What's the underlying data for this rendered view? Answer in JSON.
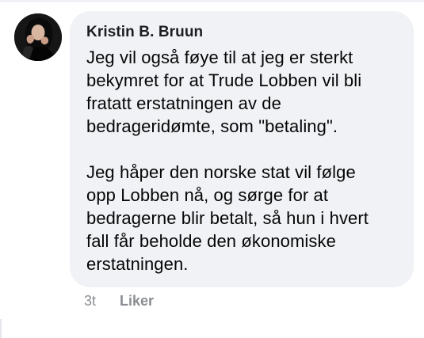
{
  "comment": {
    "author": "Kristin B. Bruun",
    "avatar_icon": "profile-photo",
    "text": "Jeg vil også føye til at jeg er sterkt\nbekymret for at Trude Lobben vil bli\nfratatt erstatningen av de\nbedrageridømte, som \"betaling\".\n\nJeg håper den norske stat vil følge\nopp Lobben nå, og sørge for at\nbedragerne blir betalt, så hun i hvert\nfall får beholde den økonomiske\nerstatningen.",
    "timestamp": "3t",
    "like_label": "Liker"
  },
  "colors": {
    "bubble_background": "#f0f2f5",
    "text": "#050505",
    "meta_text": "#8a8d91"
  }
}
